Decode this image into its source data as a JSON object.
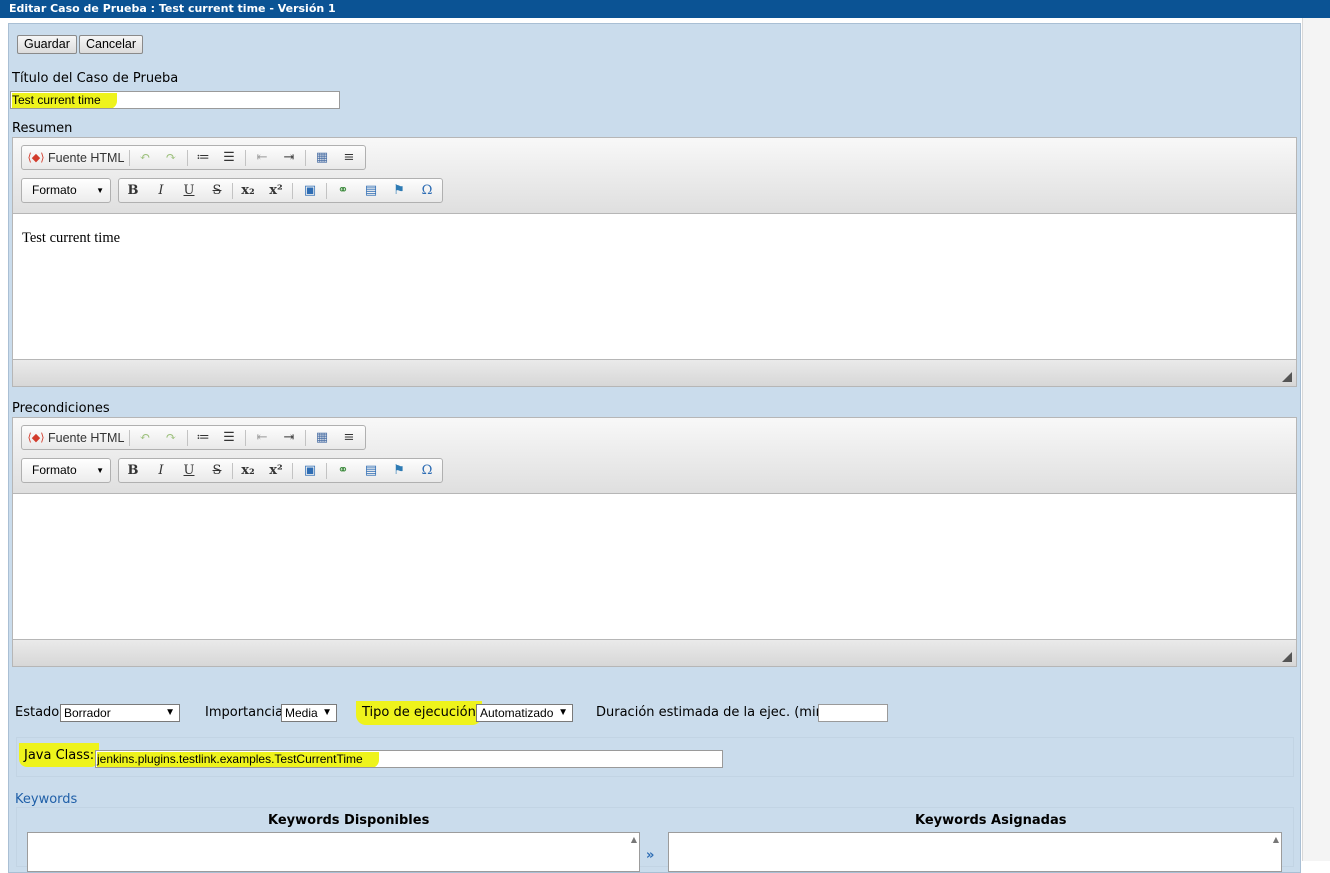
{
  "window": {
    "title": "Editar Caso de Prueba : Test current time - Versión 1"
  },
  "actions": {
    "save_label": "Guardar",
    "cancel_label": "Cancelar"
  },
  "title_field": {
    "label": "Título del Caso de Prueba",
    "value": "Test current time"
  },
  "summary": {
    "label": "Resumen",
    "content": "Test current time"
  },
  "preconditions": {
    "label": "Precondiciones",
    "content": ""
  },
  "editor_toolbar": {
    "source_label": "Fuente HTML",
    "format_label": "Formato",
    "bold": "B",
    "italic": "I",
    "underline": "U",
    "strike": "S",
    "subscript": "x₂",
    "superscript": "x²",
    "omega": "Ω"
  },
  "meta": {
    "estado_label": "Estado",
    "estado_value": "Borrador",
    "importancia_label": "Importancia",
    "importancia_value": "Media",
    "tipo_label": "Tipo de ejecución",
    "tipo_value": "Automatizado",
    "duracion_label": "Duración estimada de la ejec. (min)",
    "duracion_value": ""
  },
  "java_class": {
    "label": "Java Class:",
    "value": "jenkins.plugins.testlink.examples.TestCurrentTime"
  },
  "keywords": {
    "title": "Keywords",
    "available_label": "Keywords Disponibles",
    "assigned_label": "Keywords Asignadas"
  },
  "colors": {
    "titlebar": "#0b5394",
    "panel": "#cadcec",
    "highlight": "#eef31c",
    "link": "#1f5fa8"
  }
}
